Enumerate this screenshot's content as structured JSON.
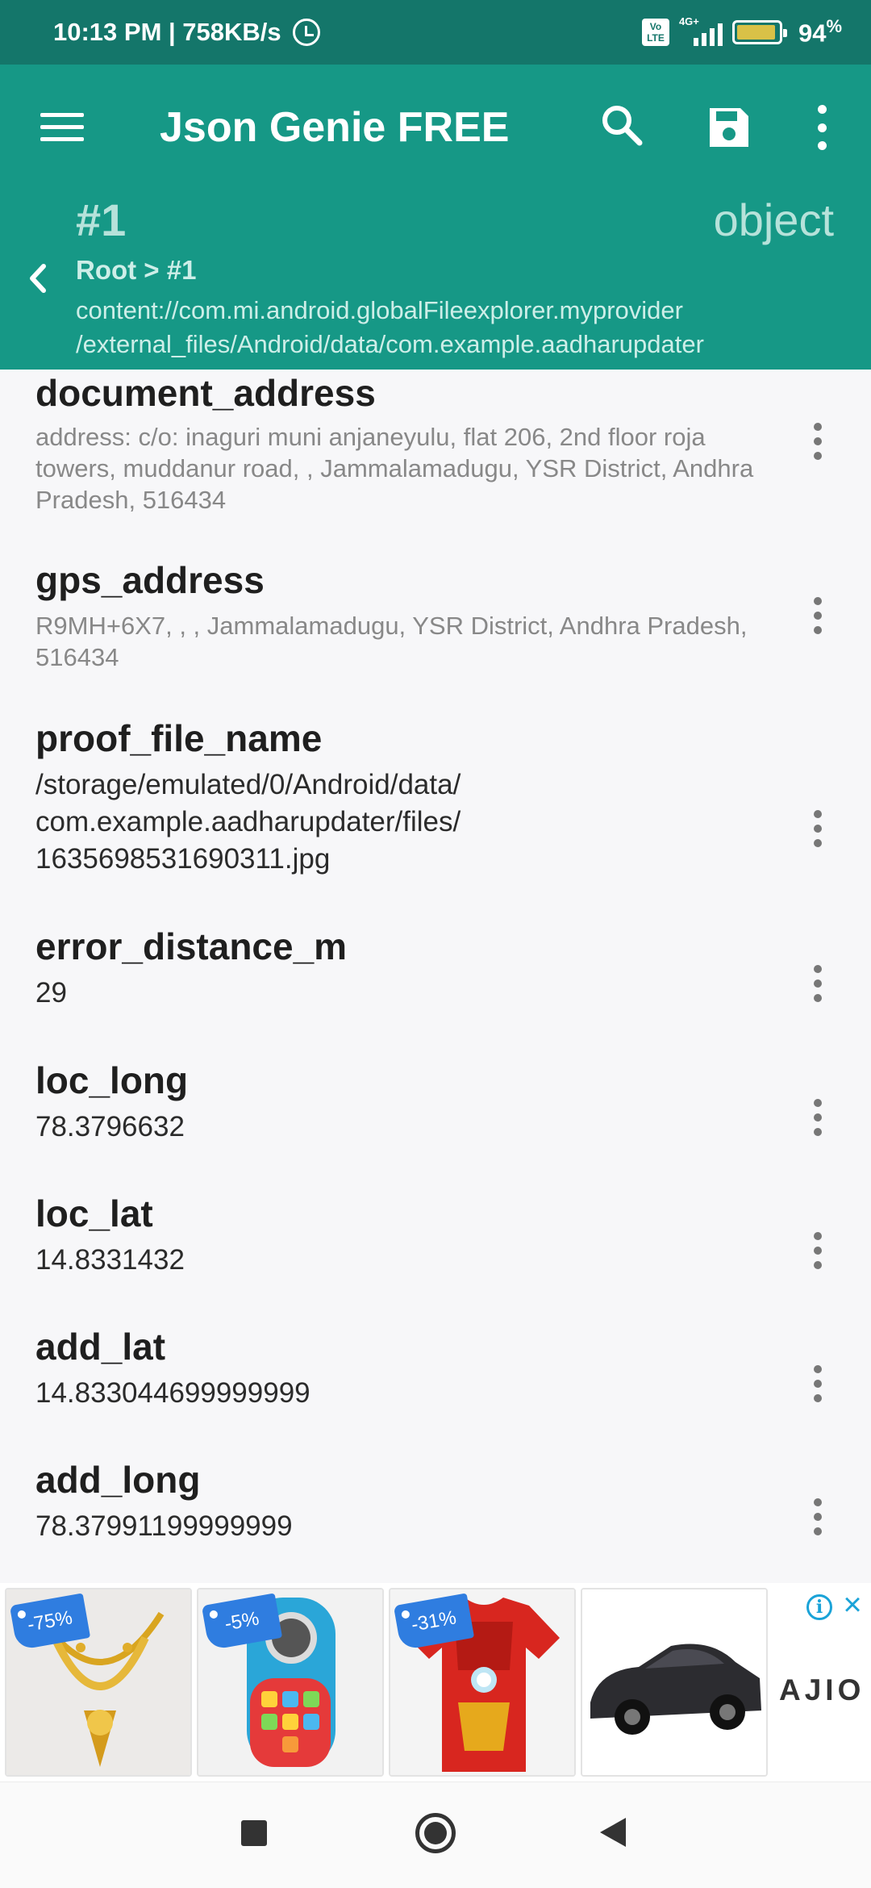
{
  "status_bar": {
    "time_speed": "10:13 PM | 758KB/s",
    "volte": "Vo LTE",
    "network": "4G+",
    "battery_pct": "94",
    "battery_unit": "%",
    "battery_level": 0.94
  },
  "app_bar": {
    "title": "Json Genie FREE",
    "node_title": "#1",
    "node_type": "object",
    "breadcrumb": "Root > #1",
    "path_line1": "content://com.mi.android.globalFileexplorer.myprovider",
    "path_line2": "/external_files/Android/data/com.example.aadharupdater"
  },
  "items": [
    {
      "key": "document_address",
      "value": "address: c/o: inaguri muni anjaneyulu, flat 206, 2nd floor roja towers, muddanur road, , Jammalamadugu, YSR District, Andhra Pradesh, 516434"
    },
    {
      "key": "gps_address",
      "value": "R9MH+6X7, , , Jammalamadugu, YSR District, Andhra Pradesh, 516434"
    },
    {
      "key": "proof_file_name",
      "value_line1": "/storage/emulated/0/Android/data/",
      "value_line2": "com.example.aadharupdater/files/",
      "value_line3": "1635698531690311.jpg"
    },
    {
      "key": "error_distance_m",
      "value": "29"
    },
    {
      "key": "loc_long",
      "value": "78.3796632"
    },
    {
      "key": "loc_lat",
      "value": "14.8331432"
    },
    {
      "key": "add_lat",
      "value": "14.833044699999999"
    },
    {
      "key": "add_long",
      "value": "78.37991199999999"
    }
  ],
  "ad": {
    "cards": [
      {
        "discount": "-75%",
        "image": "gold-necklace"
      },
      {
        "discount": "-5%",
        "image": "toy-phone"
      },
      {
        "discount": "-31%",
        "image": "iron-man-tshirt"
      },
      {
        "discount": "",
        "image": "toy-car"
      }
    ],
    "brand": "AJIO",
    "info_icon": "i",
    "close_icon": "×"
  },
  "colors": {
    "status_bar": "#14766a",
    "app_bar": "#169886",
    "accent": "#2f7de0"
  }
}
